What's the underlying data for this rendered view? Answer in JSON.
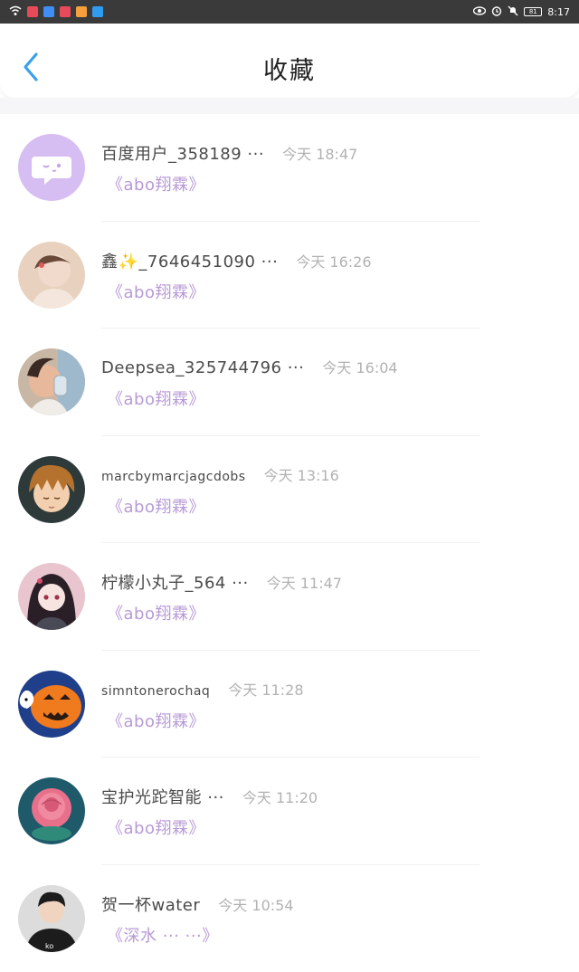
{
  "status_bar": {
    "time": "8:17",
    "battery": "81"
  },
  "header": {
    "title": "收藏"
  },
  "items": [
    {
      "username": "百度用户_358189 ···",
      "time": "今天 18:47",
      "book": "《abo翔霖》",
      "avatar": "chat-bubble-avatar"
    },
    {
      "username": "鑫✨_7646451090 ···",
      "time": "今天 16:26",
      "book": "《abo翔霖》",
      "avatar": "girl-photo-avatar"
    },
    {
      "username": "Deepsea_325744796 ···",
      "time": "今天 16:04",
      "book": "《abo翔霖》",
      "avatar": "child-drinking-avatar"
    },
    {
      "username": "marcbymarcjagcdobs",
      "time": "今天 13:16",
      "book": "《abo翔霖》",
      "avatar": "anime-boy-avatar"
    },
    {
      "username": "柠檬小丸子_564 ···",
      "time": "今天 11:47",
      "book": "《abo翔霖》",
      "avatar": "anime-girl-avatar"
    },
    {
      "username": "simntonerochaq",
      "time": "今天 11:28",
      "book": "《abo翔霖》",
      "avatar": "pumpkin-avatar"
    },
    {
      "username": "宝护光跎智能 ···",
      "time": "今天 11:20",
      "book": "《abo翔霖》",
      "avatar": "rose-avatar"
    },
    {
      "username": "贺一杯water",
      "time": "今天 10:54",
      "book": "《深水 ··· ···》",
      "avatar": "boy-photo-avatar"
    }
  ]
}
